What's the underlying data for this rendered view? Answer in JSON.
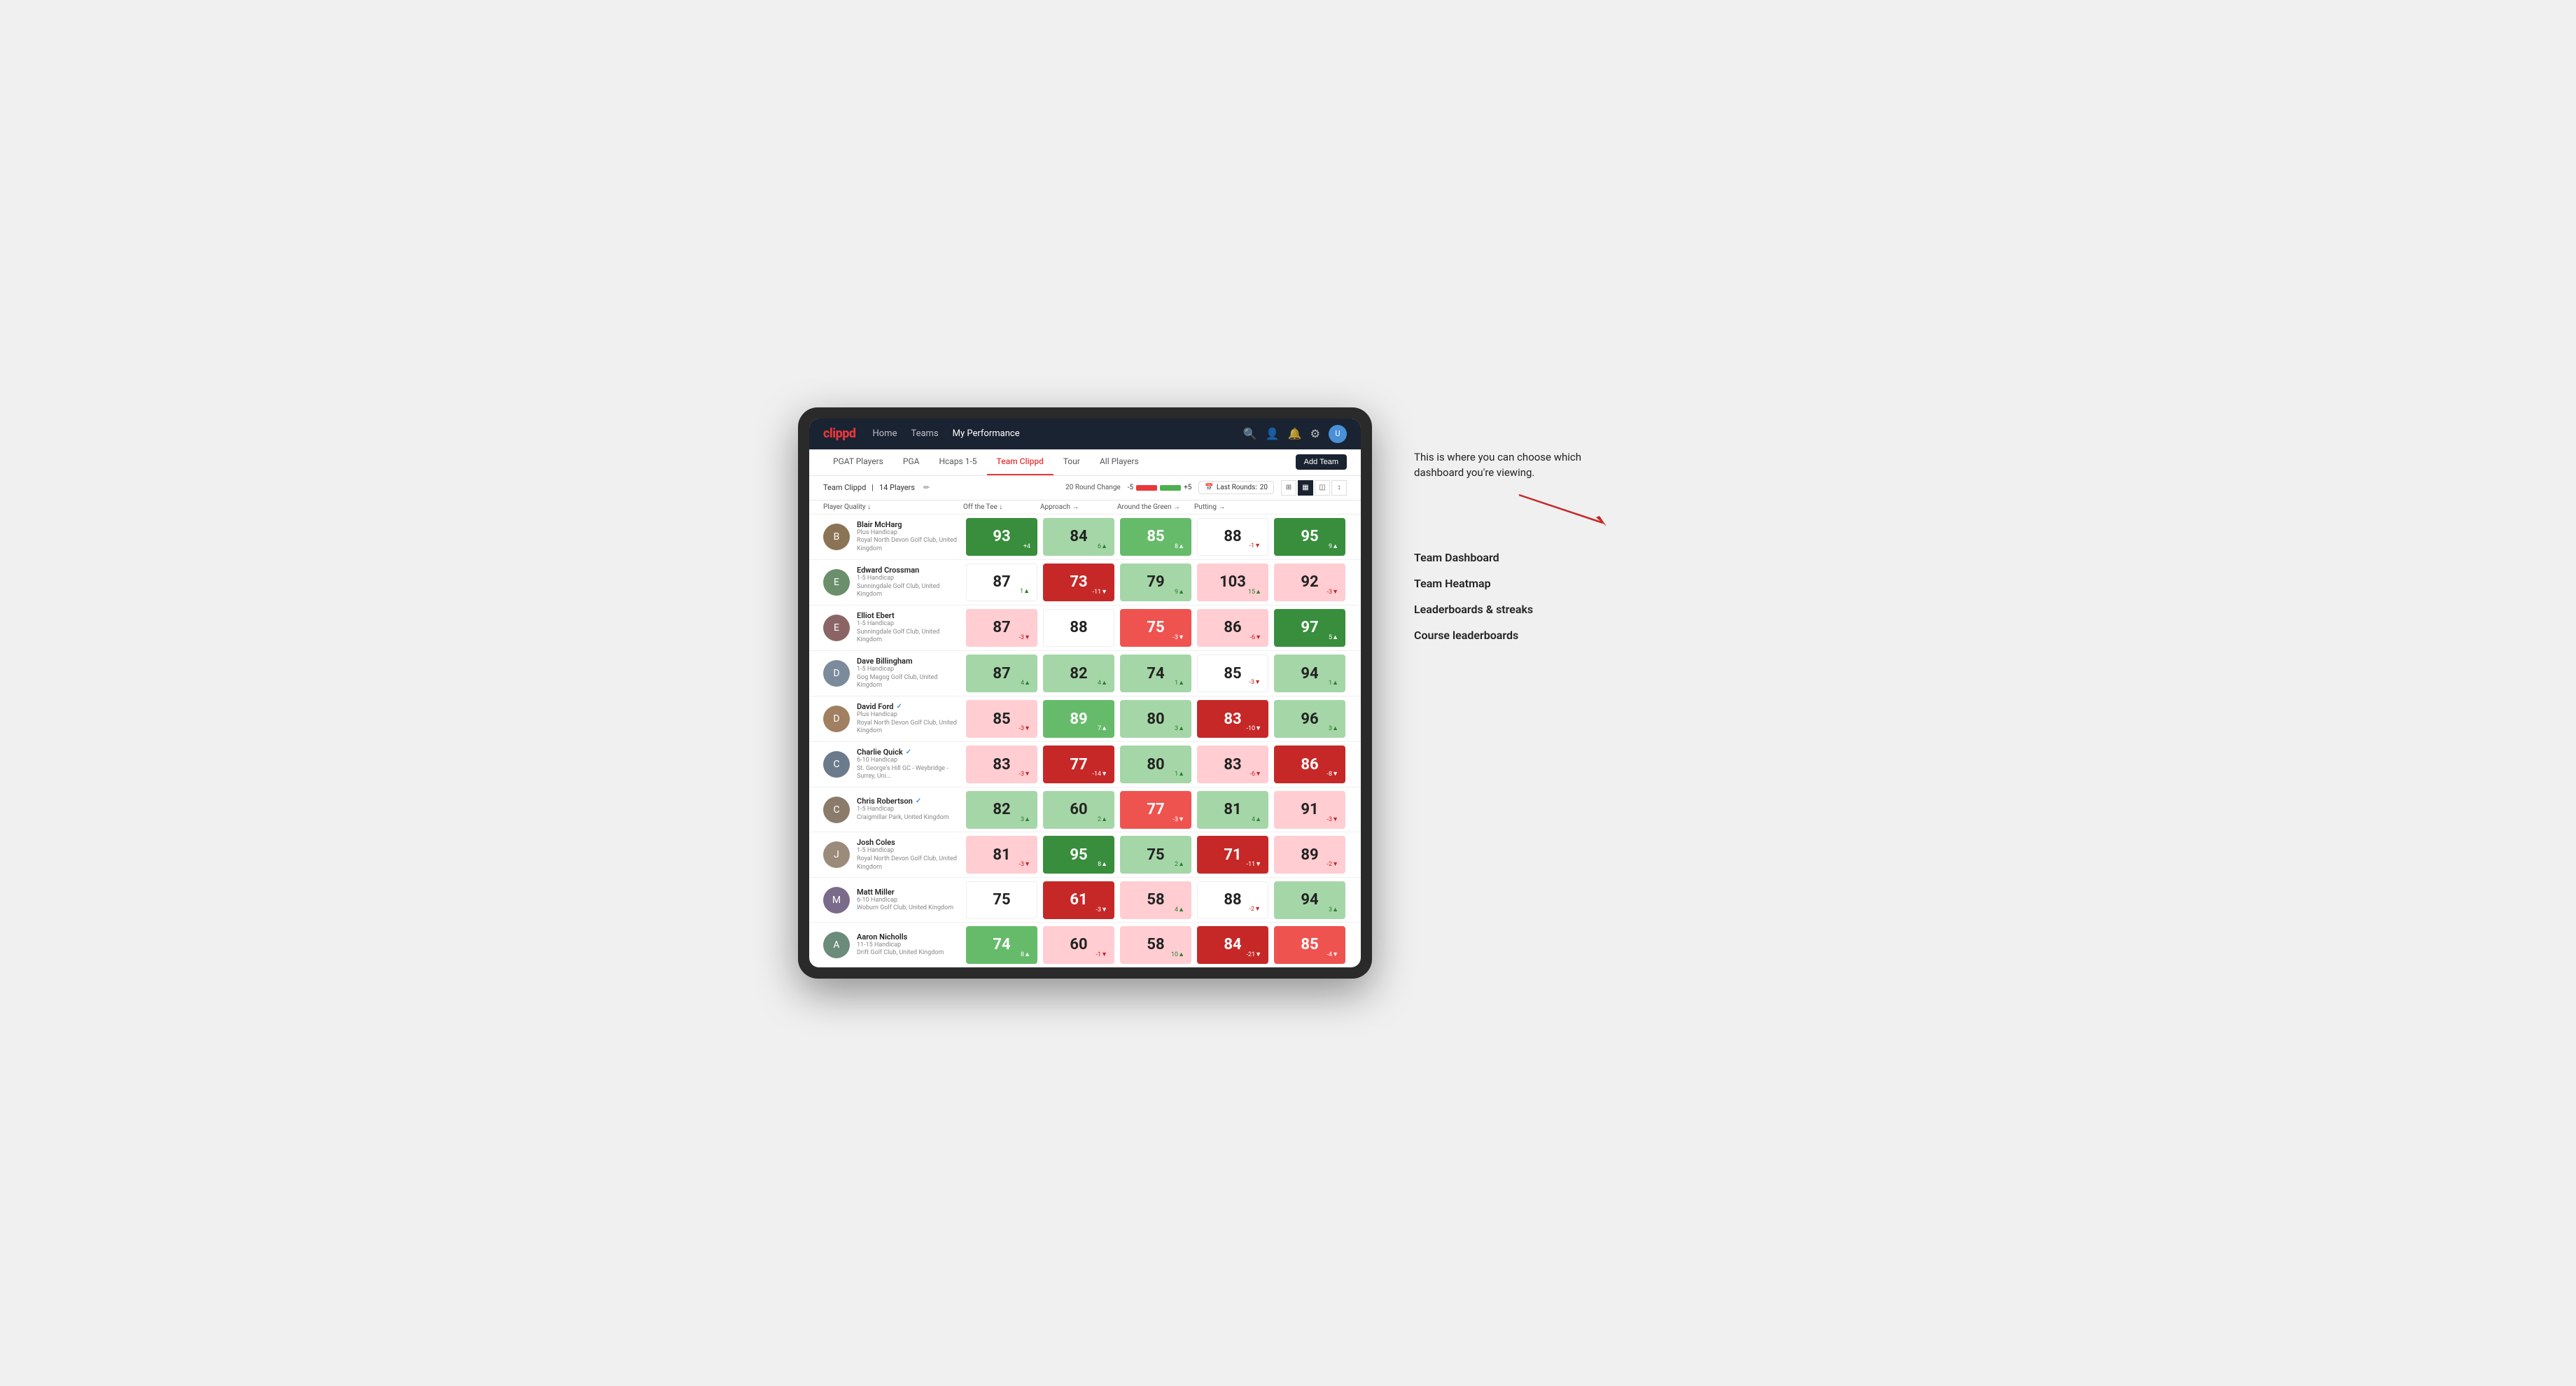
{
  "brand": "clippd",
  "navbar": {
    "links": [
      "Home",
      "Teams",
      "My Performance"
    ],
    "active_link": "My Performance",
    "icons": [
      "search",
      "person",
      "notifications",
      "settings",
      "avatar"
    ]
  },
  "tabs": {
    "items": [
      "PGAT Players",
      "PGA",
      "Hcaps 1-5",
      "Team Clippd",
      "Tour",
      "All Players"
    ],
    "active": "Team Clippd",
    "add_button": "Add Team"
  },
  "subheader": {
    "team_name": "Team Clippd",
    "player_count": "14 Players",
    "round_change_label": "20 Round Change",
    "minus": "-5",
    "plus": "+5",
    "last_rounds_label": "Last Rounds:",
    "last_rounds_value": "20"
  },
  "columns": {
    "headers": [
      "Player Quality ↓",
      "Off the Tee ↓",
      "Approach →",
      "Around the Green →",
      "Putting →"
    ]
  },
  "players": [
    {
      "name": "Blair McHarg",
      "handicap": "Plus Handicap",
      "club": "Royal North Devon Golf Club, United Kingdom",
      "verified": false,
      "avatar_color": "#8B7355",
      "scores": [
        {
          "value": 93,
          "change": "+4",
          "trend": "up",
          "bg": "bg-green-strong"
        },
        {
          "value": 84,
          "change": "6▲",
          "trend": "up",
          "bg": "bg-green-light"
        },
        {
          "value": 85,
          "change": "8▲",
          "trend": "up",
          "bg": "bg-green-medium"
        },
        {
          "value": 88,
          "change": "-1▼",
          "trend": "down",
          "bg": "bg-white"
        },
        {
          "value": 95,
          "change": "9▲",
          "trend": "up",
          "bg": "bg-green-strong"
        }
      ]
    },
    {
      "name": "Edward Crossman",
      "handicap": "1-5 Handicap",
      "club": "Sunningdale Golf Club, United Kingdom",
      "verified": false,
      "avatar_color": "#6B8E6B",
      "scores": [
        {
          "value": 87,
          "change": "1▲",
          "trend": "up",
          "bg": "bg-white"
        },
        {
          "value": 73,
          "change": "-11▼",
          "trend": "down",
          "bg": "bg-red-strong"
        },
        {
          "value": 79,
          "change": "9▲",
          "trend": "up",
          "bg": "bg-green-light"
        },
        {
          "value": 103,
          "change": "15▲",
          "trend": "up",
          "bg": "bg-red-light"
        },
        {
          "value": 92,
          "change": "-3▼",
          "trend": "down",
          "bg": "bg-red-light"
        }
      ]
    },
    {
      "name": "Elliot Ebert",
      "handicap": "1-5 Handicap",
      "club": "Sunningdale Golf Club, United Kingdom",
      "verified": false,
      "avatar_color": "#8B6565",
      "scores": [
        {
          "value": 87,
          "change": "-3▼",
          "trend": "down",
          "bg": "bg-red-light"
        },
        {
          "value": 88,
          "change": "",
          "trend": "none",
          "bg": "bg-white"
        },
        {
          "value": 75,
          "change": "-3▼",
          "trend": "down",
          "bg": "bg-red-medium"
        },
        {
          "value": 86,
          "change": "-6▼",
          "trend": "down",
          "bg": "bg-red-light"
        },
        {
          "value": 97,
          "change": "5▲",
          "trend": "up",
          "bg": "bg-green-strong"
        }
      ]
    },
    {
      "name": "Dave Billingham",
      "handicap": "1-5 Handicap",
      "club": "Gog Magog Golf Club, United Kingdom",
      "verified": false,
      "avatar_color": "#7B8B9B",
      "scores": [
        {
          "value": 87,
          "change": "4▲",
          "trend": "up",
          "bg": "bg-green-light"
        },
        {
          "value": 82,
          "change": "4▲",
          "trend": "up",
          "bg": "bg-green-light"
        },
        {
          "value": 74,
          "change": "1▲",
          "trend": "up",
          "bg": "bg-green-light"
        },
        {
          "value": 85,
          "change": "-3▼",
          "trend": "down",
          "bg": "bg-white"
        },
        {
          "value": 94,
          "change": "1▲",
          "trend": "up",
          "bg": "bg-green-light"
        }
      ]
    },
    {
      "name": "David Ford",
      "handicap": "Plus Handicap",
      "club": "Royal North Devon Golf Club, United Kingdom",
      "verified": true,
      "avatar_color": "#A08060",
      "scores": [
        {
          "value": 85,
          "change": "-3▼",
          "trend": "down",
          "bg": "bg-red-light"
        },
        {
          "value": 89,
          "change": "7▲",
          "trend": "up",
          "bg": "bg-green-medium"
        },
        {
          "value": 80,
          "change": "3▲",
          "trend": "up",
          "bg": "bg-green-light"
        },
        {
          "value": 83,
          "change": "-10▼",
          "trend": "down",
          "bg": "bg-red-strong"
        },
        {
          "value": 96,
          "change": "3▲",
          "trend": "up",
          "bg": "bg-green-light"
        }
      ]
    },
    {
      "name": "Charlie Quick",
      "handicap": "6-10 Handicap",
      "club": "St. George's Hill GC - Weybridge - Surrey, Uni...",
      "verified": true,
      "avatar_color": "#6B7B8B",
      "scores": [
        {
          "value": 83,
          "change": "-3▼",
          "trend": "down",
          "bg": "bg-red-light"
        },
        {
          "value": 77,
          "change": "-14▼",
          "trend": "down",
          "bg": "bg-red-strong"
        },
        {
          "value": 80,
          "change": "1▲",
          "trend": "up",
          "bg": "bg-green-light"
        },
        {
          "value": 83,
          "change": "-6▼",
          "trend": "down",
          "bg": "bg-red-light"
        },
        {
          "value": 86,
          "change": "-8▼",
          "trend": "down",
          "bg": "bg-red-strong"
        }
      ]
    },
    {
      "name": "Chris Robertson",
      "handicap": "1-5 Handicap",
      "club": "Craigmillar Park, United Kingdom",
      "verified": true,
      "avatar_color": "#8B7B6B",
      "scores": [
        {
          "value": 82,
          "change": "3▲",
          "trend": "up",
          "bg": "bg-green-light"
        },
        {
          "value": 60,
          "change": "2▲",
          "trend": "up",
          "bg": "bg-green-light"
        },
        {
          "value": 77,
          "change": "-3▼",
          "trend": "down",
          "bg": "bg-red-medium"
        },
        {
          "value": 81,
          "change": "4▲",
          "trend": "up",
          "bg": "bg-green-light"
        },
        {
          "value": 91,
          "change": "-3▼",
          "trend": "down",
          "bg": "bg-red-light"
        }
      ]
    },
    {
      "name": "Josh Coles",
      "handicap": "1-5 Handicap",
      "club": "Royal North Devon Golf Club, United Kingdom",
      "verified": false,
      "avatar_color": "#9B8B7B",
      "scores": [
        {
          "value": 81,
          "change": "-3▼",
          "trend": "down",
          "bg": "bg-red-light"
        },
        {
          "value": 95,
          "change": "8▲",
          "trend": "up",
          "bg": "bg-green-strong"
        },
        {
          "value": 75,
          "change": "2▲",
          "trend": "up",
          "bg": "bg-green-light"
        },
        {
          "value": 71,
          "change": "-11▼",
          "trend": "down",
          "bg": "bg-red-strong"
        },
        {
          "value": 89,
          "change": "-2▼",
          "trend": "down",
          "bg": "bg-red-light"
        }
      ]
    },
    {
      "name": "Matt Miller",
      "handicap": "6-10 Handicap",
      "club": "Woburn Golf Club, United Kingdom",
      "verified": false,
      "avatar_color": "#7B6B8B",
      "scores": [
        {
          "value": 75,
          "change": "",
          "trend": "none",
          "bg": "bg-white"
        },
        {
          "value": 61,
          "change": "-3▼",
          "trend": "down",
          "bg": "bg-red-strong"
        },
        {
          "value": 58,
          "change": "4▲",
          "trend": "up",
          "bg": "bg-red-light"
        },
        {
          "value": 88,
          "change": "-2▼",
          "trend": "down",
          "bg": "bg-white"
        },
        {
          "value": 94,
          "change": "3▲",
          "trend": "up",
          "bg": "bg-green-light"
        }
      ]
    },
    {
      "name": "Aaron Nicholls",
      "handicap": "11-15 Handicap",
      "club": "Drift Golf Club, United Kingdom",
      "verified": false,
      "avatar_color": "#6B8B7B",
      "scores": [
        {
          "value": 74,
          "change": "8▲",
          "trend": "up",
          "bg": "bg-green-medium"
        },
        {
          "value": 60,
          "change": "-1▼",
          "trend": "down",
          "bg": "bg-red-light"
        },
        {
          "value": 58,
          "change": "10▲",
          "trend": "up",
          "bg": "bg-red-light"
        },
        {
          "value": 84,
          "change": "-21▼",
          "trend": "down",
          "bg": "bg-red-strong"
        },
        {
          "value": 85,
          "change": "-4▼",
          "trend": "down",
          "bg": "bg-red-medium"
        }
      ]
    }
  ],
  "annotation": {
    "intro_text": "This is where you can choose which dashboard you're viewing.",
    "list_items": [
      "Team Dashboard",
      "Team Heatmap",
      "Leaderboards & streaks",
      "Course leaderboards"
    ]
  }
}
